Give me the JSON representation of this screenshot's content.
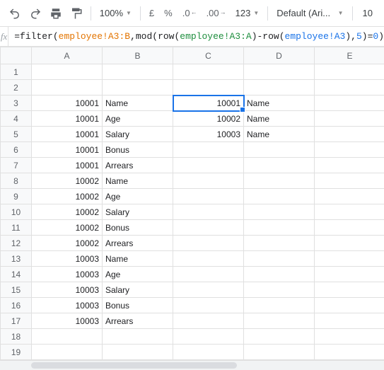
{
  "toolbar": {
    "zoom": "100%",
    "currency": "£",
    "percent": "%",
    "dec_dec": ".0",
    "dec_inc": ".00",
    "num_fmt": "123",
    "font": "Default (Ari...",
    "font_size": "10"
  },
  "formula": {
    "prefix": "=filter(",
    "r1": "employee!A3:B",
    "mid1": ",mod(row(",
    "r2": "employee!A3:A",
    "mid2": ")-row(",
    "r3": "employee!A3",
    "mid3": "),",
    "n1": "5",
    "mid4": ")=",
    "n2": "0",
    "suffix": ")"
  },
  "columns": [
    "A",
    "B",
    "C",
    "D",
    "E"
  ],
  "rows": [
    {
      "n": 1,
      "A": "",
      "B": "",
      "C": "",
      "D": "",
      "E": ""
    },
    {
      "n": 2,
      "A": "",
      "B": "",
      "C": "",
      "D": "",
      "E": ""
    },
    {
      "n": 3,
      "A": "10001",
      "B": "Name",
      "C": "10001",
      "D": "Name",
      "E": ""
    },
    {
      "n": 4,
      "A": "10001",
      "B": "Age",
      "C": "10002",
      "D": "Name",
      "E": ""
    },
    {
      "n": 5,
      "A": "10001",
      "B": "Salary",
      "C": "10003",
      "D": "Name",
      "E": ""
    },
    {
      "n": 6,
      "A": "10001",
      "B": "Bonus",
      "C": "",
      "D": "",
      "E": ""
    },
    {
      "n": 7,
      "A": "10001",
      "B": "Arrears",
      "C": "",
      "D": "",
      "E": ""
    },
    {
      "n": 8,
      "A": "10002",
      "B": "Name",
      "C": "",
      "D": "",
      "E": ""
    },
    {
      "n": 9,
      "A": "10002",
      "B": "Age",
      "C": "",
      "D": "",
      "E": ""
    },
    {
      "n": 10,
      "A": "10002",
      "B": "Salary",
      "C": "",
      "D": "",
      "E": ""
    },
    {
      "n": 11,
      "A": "10002",
      "B": "Bonus",
      "C": "",
      "D": "",
      "E": ""
    },
    {
      "n": 12,
      "A": "10002",
      "B": "Arrears",
      "C": "",
      "D": "",
      "E": ""
    },
    {
      "n": 13,
      "A": "10003",
      "B": "Name",
      "C": "",
      "D": "",
      "E": ""
    },
    {
      "n": 14,
      "A": "10003",
      "B": "Age",
      "C": "",
      "D": "",
      "E": ""
    },
    {
      "n": 15,
      "A": "10003",
      "B": "Salary",
      "C": "",
      "D": "",
      "E": ""
    },
    {
      "n": 16,
      "A": "10003",
      "B": "Bonus",
      "C": "",
      "D": "",
      "E": ""
    },
    {
      "n": 17,
      "A": "10003",
      "B": "Arrears",
      "C": "",
      "D": "",
      "E": ""
    },
    {
      "n": 18,
      "A": "",
      "B": "",
      "C": "",
      "D": "",
      "E": ""
    },
    {
      "n": 19,
      "A": "",
      "B": "",
      "C": "",
      "D": "",
      "E": ""
    }
  ],
  "active_cell": "C3"
}
